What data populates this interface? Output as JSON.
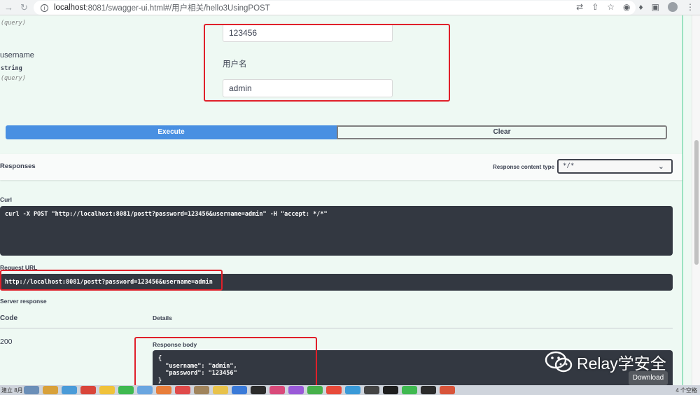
{
  "browser": {
    "url_host": "localhost",
    "url_rest": ":8081/swagger-ui.html#/用户相关/hello3UsingPOST"
  },
  "params": {
    "password_in": "(query)",
    "password_value": "123456",
    "username": {
      "name": "username",
      "type": "string",
      "in": "(query)",
      "description": "用户名",
      "value": "admin"
    }
  },
  "actions": {
    "execute": "Execute",
    "clear": "Clear"
  },
  "responses": {
    "title": "Responses",
    "content_type_label": "Response content type",
    "content_type_value": "*/*"
  },
  "curl": {
    "label": "Curl",
    "command": "curl -X POST \"http://localhost:8081/postt?password=123456&username=admin\" -H \"accept: */*\""
  },
  "request_url": {
    "label": "Request URL",
    "value": "http://localhost:8081/postt?password=123456&username=admin"
  },
  "server_response": {
    "label": "Server response",
    "col_code": "Code",
    "col_details": "Details",
    "code": "200",
    "body_label": "Response body",
    "body": "{\n  \"username\": \"admin\",\n  \"password\": \"123456\"\n}",
    "download": "Download"
  },
  "watermark": {
    "text": "Relay学安全"
  },
  "dock": {
    "left_text": "建立 8月",
    "right_text": "4 个空格"
  },
  "colors": {
    "execute_blue": "#4990e2",
    "code_bg": "#333841",
    "highlight_red": "#e0202a",
    "page_bg": "#eef9f3"
  }
}
